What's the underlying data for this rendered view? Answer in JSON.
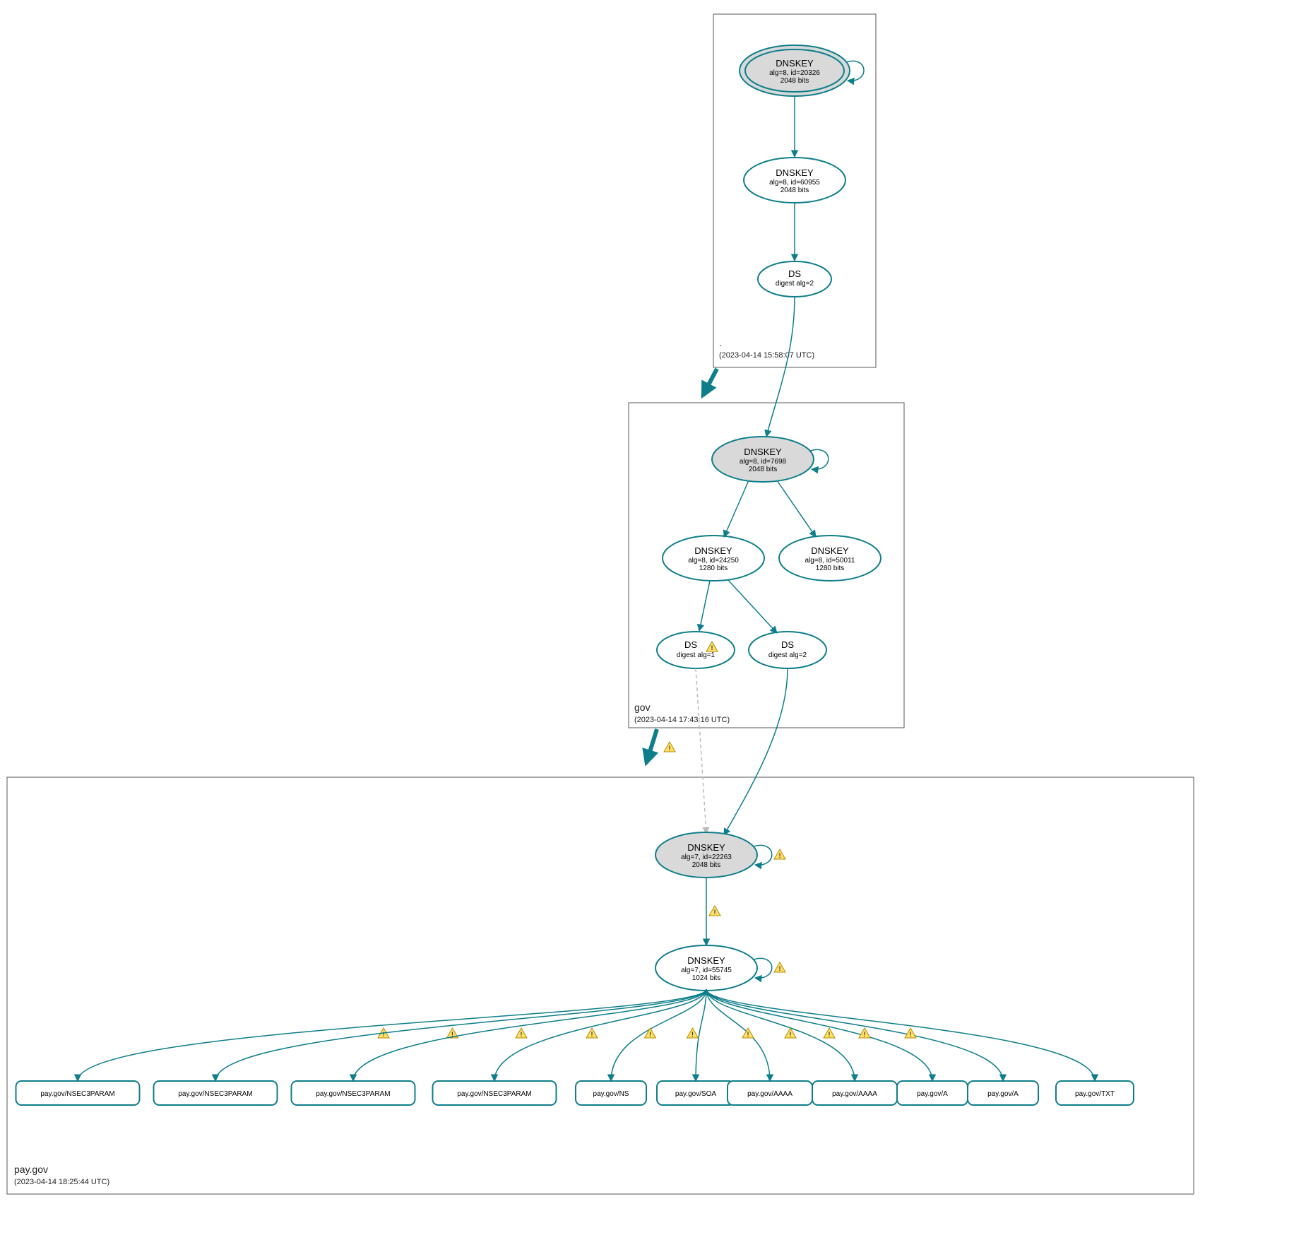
{
  "chart_data": {
    "type": "graph",
    "description": "DNSSEC delegation / authentication chain",
    "zones": [
      {
        "id": "root",
        "label": ".",
        "timestamp": "(2023-04-14 15:58:07 UTC)",
        "nodes": [
          {
            "id": "root-ksk",
            "kind": "dnskey-ksk",
            "title": "DNSKEY",
            "line2": "alg=8, id=20326",
            "line3": "2048 bits"
          },
          {
            "id": "root-zsk",
            "kind": "dnskey",
            "title": "DNSKEY",
            "line2": "alg=8, id=60955",
            "line3": "2048 bits"
          },
          {
            "id": "root-ds",
            "kind": "ds",
            "title": "DS",
            "line2": "digest alg=2"
          }
        ]
      },
      {
        "id": "gov",
        "label": "gov",
        "timestamp": "(2023-04-14 17:43:16 UTC)",
        "nodes": [
          {
            "id": "gov-ksk",
            "kind": "dnskey-ksk",
            "title": "DNSKEY",
            "line2": "alg=8, id=7698",
            "line3": "2048 bits"
          },
          {
            "id": "gov-zsk1",
            "kind": "dnskey",
            "title": "DNSKEY",
            "line2": "alg=8, id=24250",
            "line3": "1280 bits"
          },
          {
            "id": "gov-zsk2",
            "kind": "dnskey",
            "title": "DNSKEY",
            "line2": "alg=8, id=50011",
            "line3": "1280 bits"
          },
          {
            "id": "gov-ds1",
            "kind": "ds-warn",
            "title": "DS",
            "line2": "digest alg=1"
          },
          {
            "id": "gov-ds2",
            "kind": "ds",
            "title": "DS",
            "line2": "digest alg=2"
          }
        ]
      },
      {
        "id": "paygov",
        "label": "pay.gov",
        "timestamp": "(2023-04-14 18:25:44 UTC)",
        "nodes": [
          {
            "id": "pg-ksk",
            "kind": "dnskey-ksk",
            "title": "DNSKEY",
            "line2": "alg=7, id=22263",
            "line3": "2048 bits"
          },
          {
            "id": "pg-zsk",
            "kind": "dnskey",
            "title": "DNSKEY",
            "line2": "alg=7, id=55745",
            "line3": "1024 bits"
          },
          {
            "id": "rr0",
            "kind": "rr",
            "title": "pay.gov/NSEC3PARAM"
          },
          {
            "id": "rr1",
            "kind": "rr",
            "title": "pay.gov/NSEC3PARAM"
          },
          {
            "id": "rr2",
            "kind": "rr",
            "title": "pay.gov/NSEC3PARAM"
          },
          {
            "id": "rr3",
            "kind": "rr",
            "title": "pay.gov/NSEC3PARAM"
          },
          {
            "id": "rr4",
            "kind": "rr",
            "title": "pay.gov/NS"
          },
          {
            "id": "rr5",
            "kind": "rr",
            "title": "pay.gov/SOA"
          },
          {
            "id": "rr6",
            "kind": "rr",
            "title": "pay.gov/AAAA"
          },
          {
            "id": "rr7",
            "kind": "rr",
            "title": "pay.gov/AAAA"
          },
          {
            "id": "rr8",
            "kind": "rr",
            "title": "pay.gov/A"
          },
          {
            "id": "rr9",
            "kind": "rr",
            "title": "pay.gov/A"
          },
          {
            "id": "rr10",
            "kind": "rr",
            "title": "pay.gov/TXT"
          }
        ]
      }
    ],
    "edges": [
      {
        "from": "root-ksk",
        "to": "root-ksk",
        "self": true
      },
      {
        "from": "root-ksk",
        "to": "root-zsk"
      },
      {
        "from": "root-zsk",
        "to": "root-ds"
      },
      {
        "from": "root-ds",
        "to": "gov-ksk",
        "cross_zone": true
      },
      {
        "from": "gov-ksk",
        "to": "gov-ksk",
        "self": true
      },
      {
        "from": "gov-ksk",
        "to": "gov-zsk1"
      },
      {
        "from": "gov-ksk",
        "to": "gov-zsk2"
      },
      {
        "from": "gov-zsk1",
        "to": "gov-ds1"
      },
      {
        "from": "gov-zsk1",
        "to": "gov-ds2"
      },
      {
        "from": "gov-ds1",
        "to": "pg-ksk",
        "cross_zone": true,
        "dashed": true
      },
      {
        "from": "gov-ds2",
        "to": "pg-ksk",
        "cross_zone": true
      },
      {
        "from": "pg-ksk",
        "to": "pg-ksk",
        "self": true,
        "warn": true
      },
      {
        "from": "pg-ksk",
        "to": "pg-zsk",
        "warn": true
      },
      {
        "from": "pg-zsk",
        "to": "pg-zsk",
        "self": true,
        "warn": true
      },
      {
        "from": "pg-zsk",
        "to": "rr0",
        "warn": true
      },
      {
        "from": "pg-zsk",
        "to": "rr1",
        "warn": true
      },
      {
        "from": "pg-zsk",
        "to": "rr2",
        "warn": true
      },
      {
        "from": "pg-zsk",
        "to": "rr3",
        "warn": true
      },
      {
        "from": "pg-zsk",
        "to": "rr4",
        "warn": true
      },
      {
        "from": "pg-zsk",
        "to": "rr5",
        "warn": true
      },
      {
        "from": "pg-zsk",
        "to": "rr6",
        "warn": true
      },
      {
        "from": "pg-zsk",
        "to": "rr7",
        "warn": true
      },
      {
        "from": "pg-zsk",
        "to": "rr8",
        "warn": true
      },
      {
        "from": "pg-zsk",
        "to": "rr9",
        "warn": true
      },
      {
        "from": "pg-zsk",
        "to": "rr10",
        "warn": true
      }
    ],
    "zone_heavy_arrows": [
      {
        "from_zone": "root",
        "to_zone": "gov"
      },
      {
        "from_zone": "gov",
        "to_zone": "paygov",
        "warn": true
      }
    ]
  }
}
